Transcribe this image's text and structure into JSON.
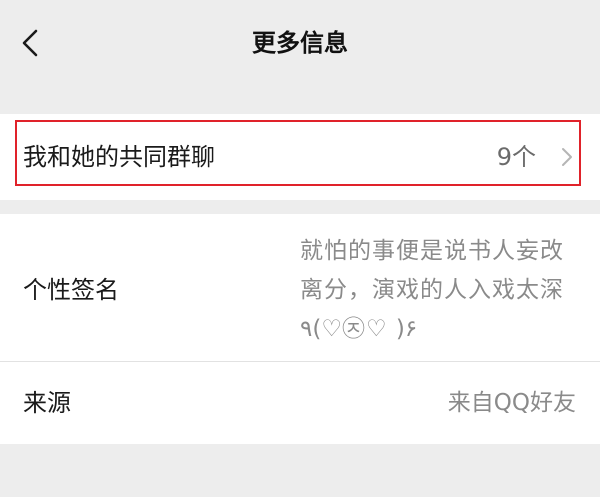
{
  "header": {
    "title": "更多信息",
    "back_icon": "chevron-left-icon"
  },
  "group_chats": {
    "label": "我和她的共同群聊",
    "count": "9个",
    "icon": "chevron-right-icon",
    "highlight_color": "#e0222a"
  },
  "signature": {
    "label": "个性签名",
    "value": "就怕的事便是说书人妄改离分，演戏的人入戏太深٩(♡㉨♡ )۶"
  },
  "source": {
    "label": "来源",
    "value": "来自QQ好友"
  },
  "colors": {
    "background": "#ededed",
    "card": "#ffffff",
    "secondary_text": "#8a8a8a"
  }
}
